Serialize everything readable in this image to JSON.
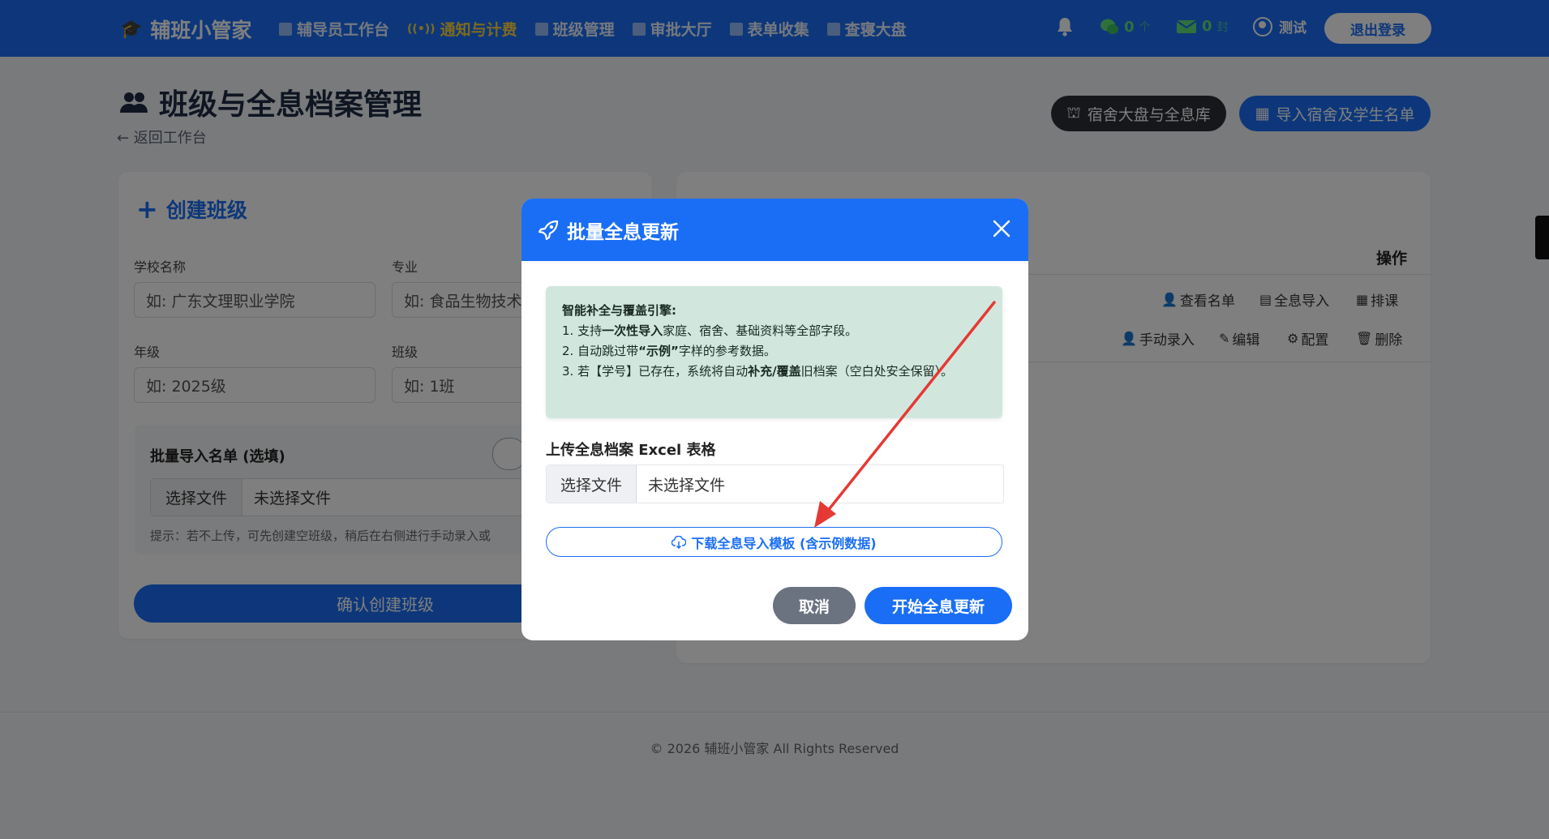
{
  "nav": {
    "brand": "辅班小管家",
    "items": [
      {
        "label": "辅导员工作台",
        "active": false
      },
      {
        "label": "通知与计费",
        "active": true
      },
      {
        "label": "班级管理",
        "active": false
      },
      {
        "label": "审批大厅",
        "active": false
      },
      {
        "label": "表单收集",
        "active": false
      },
      {
        "label": "查寝大盘",
        "active": false
      }
    ],
    "wechat_count": "0",
    "wechat_unit": "个",
    "mail_count": "0",
    "mail_unit": "封",
    "user": "测试",
    "logout": "退出登录"
  },
  "page": {
    "title": "班级与全息档案管理",
    "back_link": "← 返回工作台",
    "btn_dorm": "宿舍大盘与全息库",
    "btn_import": "导入宿舍及学生名单"
  },
  "create": {
    "title": "创建班级",
    "school_label": "学校名称",
    "school_placeholder": "如: 广东文理职业学院",
    "major_label": "专业",
    "major_placeholder": "如: 食品生物技术",
    "grade_label": "年级",
    "grade_placeholder": "如: 2025级",
    "class_label": "班级",
    "class_placeholder": "如: 1班",
    "import_title": "批量导入名单 (选填)",
    "file_btn": "选择文件",
    "file_name": "未选择文件",
    "hint": "提示：若不上传，可先创建空班级，稍后在右侧进行手动录入或",
    "confirm": "确认创建班级"
  },
  "table": {
    "op_header": "操作",
    "ops_row1": [
      "查看名单",
      "全息导入",
      "排课"
    ],
    "ops_row2": [
      "手动录入",
      "编辑",
      "配置",
      "删除"
    ]
  },
  "footer": "© 2026 辅班小管家 All Rights Reserved",
  "modal": {
    "title": "批量全息更新",
    "info_title": "智能补全与覆盖引擎:",
    "line1_a": "1. 支持",
    "line1_b": "一次性导入",
    "line1_c": "家庭、宿舍、基础资料等全部字段。",
    "line2_a": "2. 自动跳过带",
    "line2_b": "“示例”",
    "line2_c": "字样的参考数据。",
    "line3_a": "3. 若【学号】已存在，系统将自动",
    "line3_b": "补充/覆盖",
    "line3_c": "旧档案（空白处安全保留）。",
    "upload_label": "上传全息档案 Excel 表格",
    "file_btn": "选择文件",
    "file_name": "未选择文件",
    "download": "下载全息导入模板 (含示例数据)",
    "cancel": "取消",
    "start": "开始全息更新"
  },
  "colors": {
    "primary": "#1a6ef5",
    "active_nav": "#ffd43b",
    "info_bg": "#d1e7dd",
    "annotation_arrow": "#e53935"
  }
}
